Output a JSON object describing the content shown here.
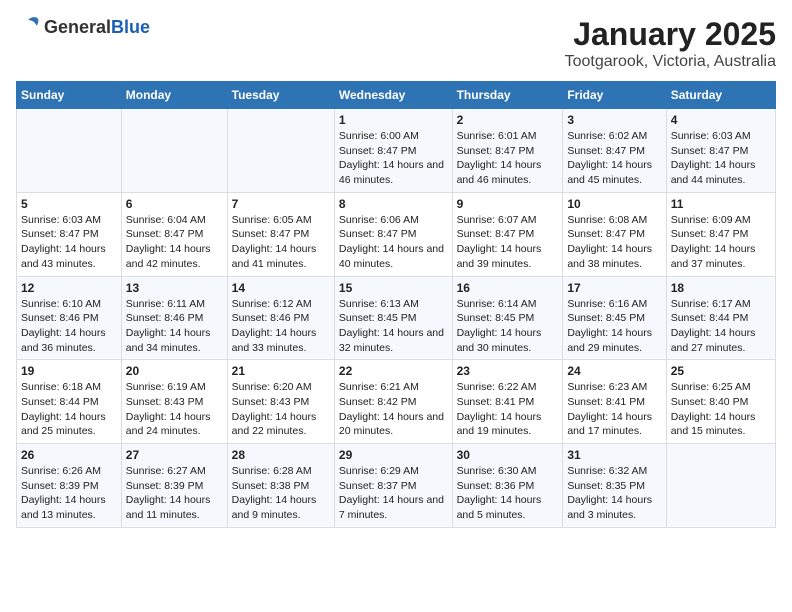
{
  "logo": {
    "general": "General",
    "blue": "Blue"
  },
  "title": "January 2025",
  "subtitle": "Tootgarook, Victoria, Australia",
  "headers": [
    "Sunday",
    "Monday",
    "Tuesday",
    "Wednesday",
    "Thursday",
    "Friday",
    "Saturday"
  ],
  "weeks": [
    [
      {
        "day": "",
        "sunrise": "",
        "sunset": "",
        "daylight": ""
      },
      {
        "day": "",
        "sunrise": "",
        "sunset": "",
        "daylight": ""
      },
      {
        "day": "",
        "sunrise": "",
        "sunset": "",
        "daylight": ""
      },
      {
        "day": "1",
        "sunrise": "Sunrise: 6:00 AM",
        "sunset": "Sunset: 8:47 PM",
        "daylight": "Daylight: 14 hours and 46 minutes."
      },
      {
        "day": "2",
        "sunrise": "Sunrise: 6:01 AM",
        "sunset": "Sunset: 8:47 PM",
        "daylight": "Daylight: 14 hours and 46 minutes."
      },
      {
        "day": "3",
        "sunrise": "Sunrise: 6:02 AM",
        "sunset": "Sunset: 8:47 PM",
        "daylight": "Daylight: 14 hours and 45 minutes."
      },
      {
        "day": "4",
        "sunrise": "Sunrise: 6:03 AM",
        "sunset": "Sunset: 8:47 PM",
        "daylight": "Daylight: 14 hours and 44 minutes."
      }
    ],
    [
      {
        "day": "5",
        "sunrise": "Sunrise: 6:03 AM",
        "sunset": "Sunset: 8:47 PM",
        "daylight": "Daylight: 14 hours and 43 minutes."
      },
      {
        "day": "6",
        "sunrise": "Sunrise: 6:04 AM",
        "sunset": "Sunset: 8:47 PM",
        "daylight": "Daylight: 14 hours and 42 minutes."
      },
      {
        "day": "7",
        "sunrise": "Sunrise: 6:05 AM",
        "sunset": "Sunset: 8:47 PM",
        "daylight": "Daylight: 14 hours and 41 minutes."
      },
      {
        "day": "8",
        "sunrise": "Sunrise: 6:06 AM",
        "sunset": "Sunset: 8:47 PM",
        "daylight": "Daylight: 14 hours and 40 minutes."
      },
      {
        "day": "9",
        "sunrise": "Sunrise: 6:07 AM",
        "sunset": "Sunset: 8:47 PM",
        "daylight": "Daylight: 14 hours and 39 minutes."
      },
      {
        "day": "10",
        "sunrise": "Sunrise: 6:08 AM",
        "sunset": "Sunset: 8:47 PM",
        "daylight": "Daylight: 14 hours and 38 minutes."
      },
      {
        "day": "11",
        "sunrise": "Sunrise: 6:09 AM",
        "sunset": "Sunset: 8:47 PM",
        "daylight": "Daylight: 14 hours and 37 minutes."
      }
    ],
    [
      {
        "day": "12",
        "sunrise": "Sunrise: 6:10 AM",
        "sunset": "Sunset: 8:46 PM",
        "daylight": "Daylight: 14 hours and 36 minutes."
      },
      {
        "day": "13",
        "sunrise": "Sunrise: 6:11 AM",
        "sunset": "Sunset: 8:46 PM",
        "daylight": "Daylight: 14 hours and 34 minutes."
      },
      {
        "day": "14",
        "sunrise": "Sunrise: 6:12 AM",
        "sunset": "Sunset: 8:46 PM",
        "daylight": "Daylight: 14 hours and 33 minutes."
      },
      {
        "day": "15",
        "sunrise": "Sunrise: 6:13 AM",
        "sunset": "Sunset: 8:45 PM",
        "daylight": "Daylight: 14 hours and 32 minutes."
      },
      {
        "day": "16",
        "sunrise": "Sunrise: 6:14 AM",
        "sunset": "Sunset: 8:45 PM",
        "daylight": "Daylight: 14 hours and 30 minutes."
      },
      {
        "day": "17",
        "sunrise": "Sunrise: 6:16 AM",
        "sunset": "Sunset: 8:45 PM",
        "daylight": "Daylight: 14 hours and 29 minutes."
      },
      {
        "day": "18",
        "sunrise": "Sunrise: 6:17 AM",
        "sunset": "Sunset: 8:44 PM",
        "daylight": "Daylight: 14 hours and 27 minutes."
      }
    ],
    [
      {
        "day": "19",
        "sunrise": "Sunrise: 6:18 AM",
        "sunset": "Sunset: 8:44 PM",
        "daylight": "Daylight: 14 hours and 25 minutes."
      },
      {
        "day": "20",
        "sunrise": "Sunrise: 6:19 AM",
        "sunset": "Sunset: 8:43 PM",
        "daylight": "Daylight: 14 hours and 24 minutes."
      },
      {
        "day": "21",
        "sunrise": "Sunrise: 6:20 AM",
        "sunset": "Sunset: 8:43 PM",
        "daylight": "Daylight: 14 hours and 22 minutes."
      },
      {
        "day": "22",
        "sunrise": "Sunrise: 6:21 AM",
        "sunset": "Sunset: 8:42 PM",
        "daylight": "Daylight: 14 hours and 20 minutes."
      },
      {
        "day": "23",
        "sunrise": "Sunrise: 6:22 AM",
        "sunset": "Sunset: 8:41 PM",
        "daylight": "Daylight: 14 hours and 19 minutes."
      },
      {
        "day": "24",
        "sunrise": "Sunrise: 6:23 AM",
        "sunset": "Sunset: 8:41 PM",
        "daylight": "Daylight: 14 hours and 17 minutes."
      },
      {
        "day": "25",
        "sunrise": "Sunrise: 6:25 AM",
        "sunset": "Sunset: 8:40 PM",
        "daylight": "Daylight: 14 hours and 15 minutes."
      }
    ],
    [
      {
        "day": "26",
        "sunrise": "Sunrise: 6:26 AM",
        "sunset": "Sunset: 8:39 PM",
        "daylight": "Daylight: 14 hours and 13 minutes."
      },
      {
        "day": "27",
        "sunrise": "Sunrise: 6:27 AM",
        "sunset": "Sunset: 8:39 PM",
        "daylight": "Daylight: 14 hours and 11 minutes."
      },
      {
        "day": "28",
        "sunrise": "Sunrise: 6:28 AM",
        "sunset": "Sunset: 8:38 PM",
        "daylight": "Daylight: 14 hours and 9 minutes."
      },
      {
        "day": "29",
        "sunrise": "Sunrise: 6:29 AM",
        "sunset": "Sunset: 8:37 PM",
        "daylight": "Daylight: 14 hours and 7 minutes."
      },
      {
        "day": "30",
        "sunrise": "Sunrise: 6:30 AM",
        "sunset": "Sunset: 8:36 PM",
        "daylight": "Daylight: 14 hours and 5 minutes."
      },
      {
        "day": "31",
        "sunrise": "Sunrise: 6:32 AM",
        "sunset": "Sunset: 8:35 PM",
        "daylight": "Daylight: 14 hours and 3 minutes."
      },
      {
        "day": "",
        "sunrise": "",
        "sunset": "",
        "daylight": ""
      }
    ]
  ]
}
